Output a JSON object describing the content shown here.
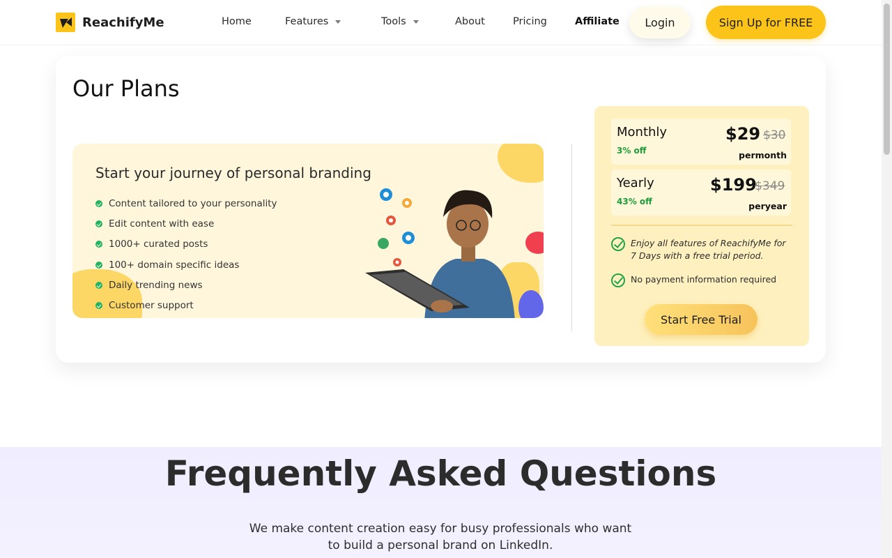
{
  "nav": {
    "brand": "ReachifyMe",
    "items": [
      {
        "label": "Home",
        "dropdown": false
      },
      {
        "label": "Features",
        "dropdown": true
      },
      {
        "label": "Tools",
        "dropdown": true
      },
      {
        "label": "About",
        "dropdown": false
      },
      {
        "label": "Pricing",
        "dropdown": false
      },
      {
        "label": "Affiliate",
        "dropdown": false
      }
    ],
    "login": "Login",
    "signup": "Sign Up for FREE"
  },
  "plans": {
    "title": "Our Plans",
    "banner": {
      "title": "Start your journey of personal branding",
      "features": [
        "Content tailored to your personality",
        "Edit content with ease",
        "1000+ curated posts",
        "100+ domain specific ideas",
        "Daily trending news",
        "Customer support"
      ]
    },
    "pricing": {
      "monthly": {
        "name": "Monthly",
        "off": "3% off",
        "price": "$29",
        "old_price": "$30",
        "period": "permonth"
      },
      "yearly": {
        "name": "Yearly",
        "off": "43% off",
        "price": "$199",
        "old_price": "$349",
        "period": "peryear"
      },
      "benefits": [
        "Enjoy all features of ReachifyMe for 7 Days with a free trial period.",
        "No payment information required"
      ],
      "cta": "Start Free Trial"
    }
  },
  "faq": {
    "title": "Frequently Asked Questions",
    "description": "We make content creation easy for busy professionals who want to build a personal brand on LinkedIn."
  },
  "colors": {
    "brand_yellow": "#fcc419",
    "success_green": "#22a34a",
    "faq_bg": "#efedff"
  }
}
